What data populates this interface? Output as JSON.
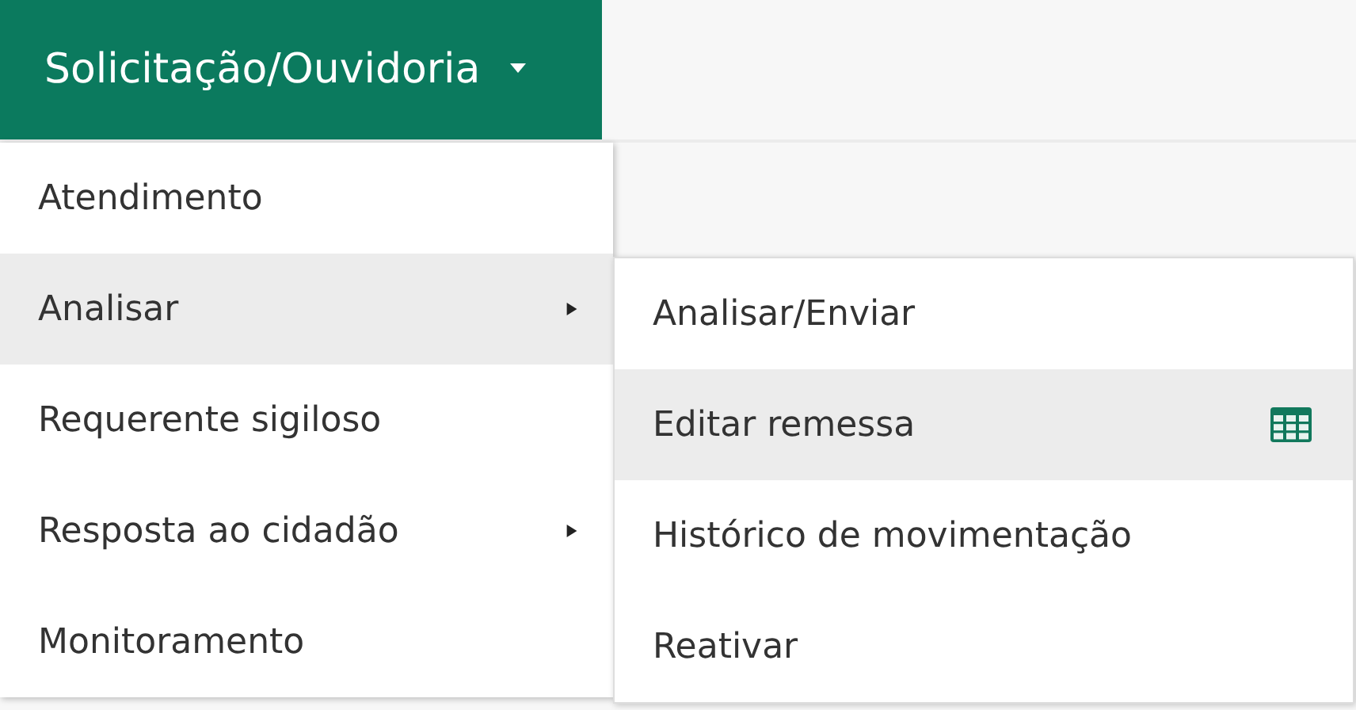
{
  "nav_tab": {
    "label": "Solicitação/Ouvidoria",
    "expanded": true
  },
  "menu": [
    {
      "label": "Atendimento",
      "selected": false,
      "has_submenu": false
    },
    {
      "label": "Analisar",
      "selected": true,
      "has_submenu": true
    },
    {
      "label": "Requerente sigiloso",
      "selected": false,
      "has_submenu": false
    },
    {
      "label": "Resposta ao cidadão",
      "selected": false,
      "has_submenu": true
    },
    {
      "label": "Monitoramento",
      "selected": false,
      "has_submenu": false
    }
  ],
  "submenu": [
    {
      "label": "Analisar/Enviar",
      "selected": false,
      "has_icon": false
    },
    {
      "label": "Editar remessa",
      "selected": true,
      "has_icon": true
    },
    {
      "label": "Histórico de movimentação",
      "selected": false,
      "has_icon": false
    },
    {
      "label": "Reativar",
      "selected": false,
      "has_icon": false
    }
  ]
}
